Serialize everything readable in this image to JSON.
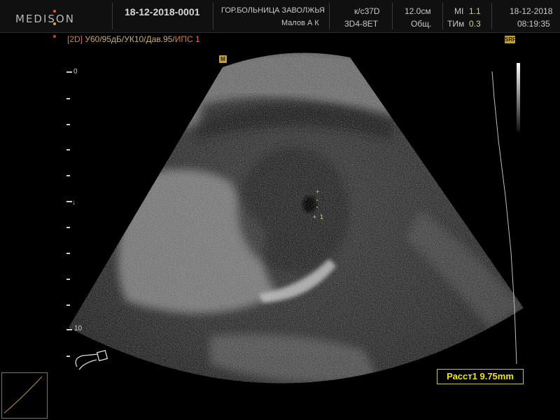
{
  "header": {
    "logo": "MEDISON",
    "logo_dot_colors": [
      "#e05a2a",
      "#f0a020",
      "#e03030"
    ],
    "patient_id": "18-12-2018-0001",
    "hospital": "ГОР.БОЛЬНИЦА ЗАВОЛЖЬЯ",
    "operator": "Малов А К",
    "preset": "к/с37D",
    "probe": "3D4-8ET",
    "depth": "12.0см",
    "exam_type": "Общ.",
    "mi_label": "MI",
    "mi_value": "1.1",
    "tim_label": "ТИм",
    "tim_value": "0.3",
    "date": "18-12-2018",
    "time": "08:19:35"
  },
  "params": {
    "mode": "[2D]",
    "settings": "У60/95дБ/УК10/Дав.95/",
    "ips": "ИПС 1"
  },
  "depth_scale": {
    "top_label": "0",
    "mid_label": "10"
  },
  "markers": {
    "orientation_badge": "M",
    "srf_badge": "SRF"
  },
  "measurement": {
    "text": "Расст1 9.75mm",
    "caliper_label": "1",
    "color": "#f3e41a"
  }
}
